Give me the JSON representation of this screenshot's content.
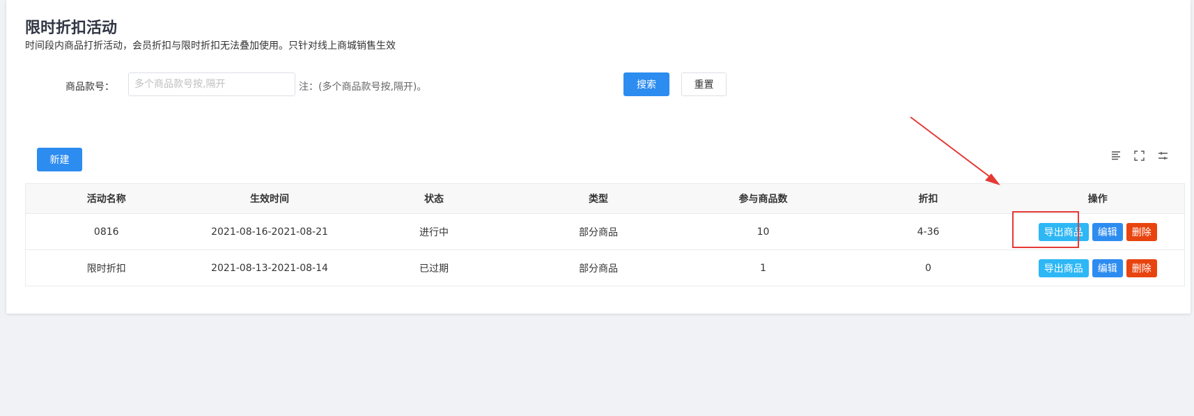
{
  "page": {
    "title": "限时折扣活动",
    "description": "时间段内商品打折活动，会员折扣与限时折扣无法叠加使用。只针对线上商城销售生效"
  },
  "search_form": {
    "label": "商品款号：",
    "input_value": "",
    "input_placeholder": "多个商品款号按,隔开",
    "note": "注：(多个商品款号按,隔开)。",
    "search_label": "搜索",
    "reset_label": "重置"
  },
  "toolbar": {
    "new_label": "新建",
    "icons": [
      "density-icon",
      "fullscreen-icon",
      "column-settings-icon"
    ]
  },
  "table": {
    "columns": [
      "活动名称",
      "生效时间",
      "状态",
      "类型",
      "参与商品数",
      "折扣",
      "操作"
    ],
    "rows": [
      {
        "name": "0816",
        "period": "2021-08-16-2021-08-21",
        "status": "进行中",
        "type": "部分商品",
        "count": "10",
        "discount": "4-36"
      },
      {
        "name": "限时折扣",
        "period": "2021-08-13-2021-08-14",
        "status": "已过期",
        "type": "部分商品",
        "count": "1",
        "discount": "0"
      }
    ],
    "actions": {
      "export": "导出商品",
      "edit": "编辑",
      "delete": "删除"
    }
  },
  "colors": {
    "primary": "#2d8cf0",
    "info": "#2db7f5",
    "danger": "#e8440f",
    "annotation": "#e53935"
  }
}
